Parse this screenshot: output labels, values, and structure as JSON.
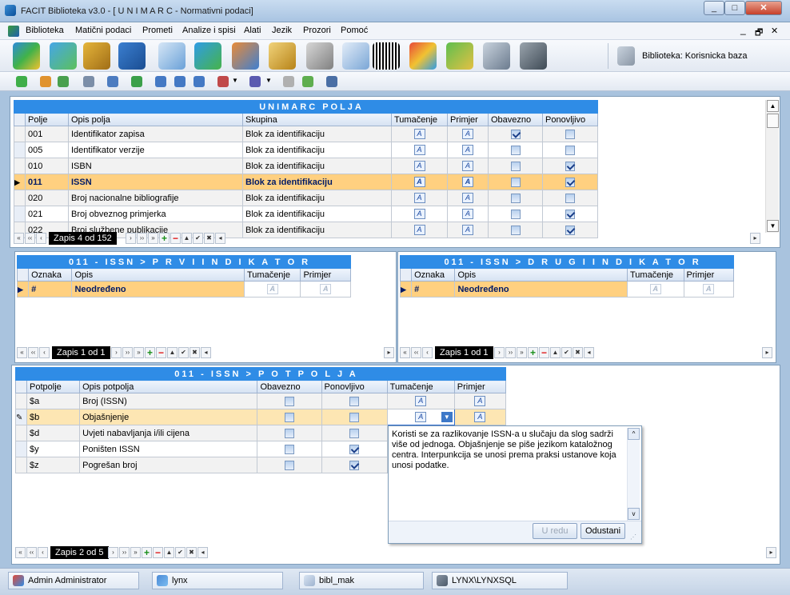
{
  "window": {
    "title": "FACIT Biblioteka v3.0 - [ U N I M A R C - Normativni podaci]"
  },
  "menu": [
    "Biblioteka",
    "Matični podaci",
    "Prometi",
    "Analize i spisi",
    "Alati",
    "Jezik",
    "Prozori",
    "Pomoć"
  ],
  "library_label": "Biblioteka: Korisnicka baza",
  "unimarc": {
    "caption": "UNIMARC POLJA",
    "headers": [
      "Polje",
      "Opis polja",
      "Skupina",
      "Tumačenje",
      "Primjer",
      "Obavezno",
      "Ponovljivo"
    ],
    "rows": [
      {
        "polje": "001",
        "opis": "Identifikator zapisa",
        "skupina": "Blok za identifikaciju",
        "obavezno": true,
        "ponovljivo": false
      },
      {
        "polje": "005",
        "opis": "Identifikator verzije",
        "skupina": "Blok za identifikaciju",
        "obavezno": false,
        "ponovljivo": false
      },
      {
        "polje": "010",
        "opis": "ISBN",
        "skupina": "Blok za identifikaciju",
        "obavezno": false,
        "ponovljivo": true
      },
      {
        "polje": "011",
        "opis": "ISSN",
        "skupina": "Blok za identifikaciju",
        "obavezno": false,
        "ponovljivo": true,
        "selected": true
      },
      {
        "polje": "020",
        "opis": "Broj nacionalne bibliografije",
        "skupina": "Blok za identifikaciju",
        "obavezno": false,
        "ponovljivo": false
      },
      {
        "polje": "021",
        "opis": "Broj obveznog primjerka",
        "skupina": "Blok za identifikaciju",
        "obavezno": false,
        "ponovljivo": true
      },
      {
        "polje": "022",
        "opis": "Broj službene publikacije",
        "skupina": "Blok za identifikaciju",
        "obavezno": false,
        "ponovljivo": true
      }
    ],
    "record": "Zapis 4 od 152"
  },
  "first_indicator": {
    "caption": "011 - ISSN > P R V I   I N D I K A T O R",
    "headers": [
      "Oznaka",
      "Opis",
      "Tumačenje",
      "Primjer"
    ],
    "rows": [
      {
        "oznaka": "#",
        "opis": "Neodređeno"
      }
    ],
    "record": "Zapis 1 od 1"
  },
  "second_indicator": {
    "caption": "011 - ISSN > D R U G I   I N D I K A T O R",
    "headers": [
      "Oznaka",
      "Opis",
      "Tumačenje",
      "Primjer"
    ],
    "rows": [
      {
        "oznaka": "#",
        "opis": "Neodređeno"
      }
    ],
    "record": "Zapis 1 od 1"
  },
  "subfields": {
    "caption": "011 - ISSN > P O T P O L J A",
    "headers": [
      "Potpolje",
      "Opis potpolja",
      "Obavezno",
      "Ponovljivo",
      "Tumačenje",
      "Primjer"
    ],
    "rows": [
      {
        "code": "$a",
        "opis": "Broj (ISSN)",
        "obavezno": false,
        "ponovljivo": false
      },
      {
        "code": "$b",
        "opis": "Objašnjenje",
        "obavezno": false,
        "ponovljivo": false,
        "editing": true
      },
      {
        "code": "$d",
        "opis": "Uvjeti nabavljanja i/ili cijena",
        "obavezno": false,
        "ponovljivo": false
      },
      {
        "code": "$y",
        "opis": "Poništen ISSN",
        "obavezno": false,
        "ponovljivo": true
      },
      {
        "code": "$z",
        "opis": "Pogrešan broj",
        "obavezno": false,
        "ponovljivo": true
      }
    ],
    "record": "Zapis 2 od 5"
  },
  "memo": {
    "text": "Koristi se za razlikovanje ISSN-a u slučaju da slog sadrži više od jednoga. Objašnjenje se piše jezikom kataložnog centra. Interpunkcija se unosi prema praksi ustanove koja unosi podatke.",
    "ok_label": "U redu",
    "cancel_label": "Odustani"
  },
  "statusbar": [
    "Admin Administrator",
    "lynx",
    "bibl_mak",
    "LYNX\\LYNXSQL"
  ]
}
